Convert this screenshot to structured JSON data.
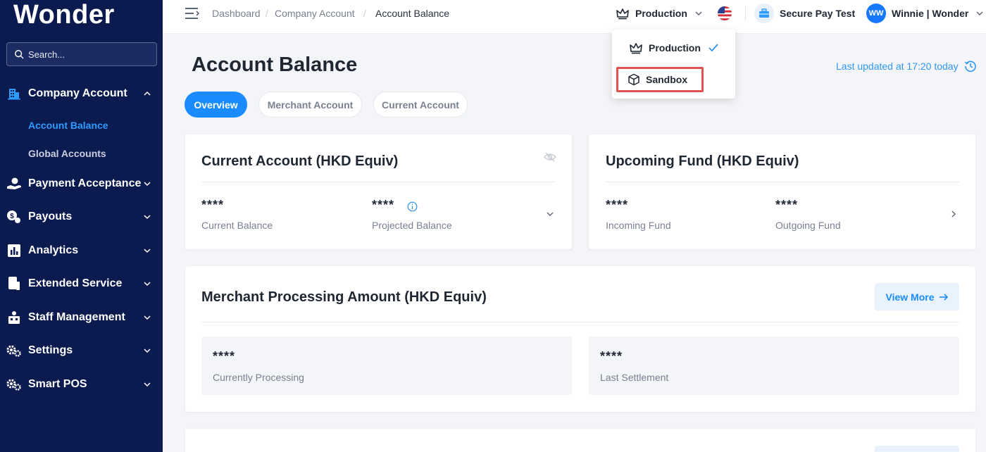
{
  "sidebar": {
    "logo": "Wonder",
    "search_placeholder": "Search...",
    "items": [
      {
        "label": "Company Account",
        "icon": "building-icon",
        "expanded": true
      },
      {
        "label": "Payment Acceptance",
        "icon": "hand-coin-icon"
      },
      {
        "label": "Payouts",
        "icon": "payout-icon"
      },
      {
        "label": "Analytics",
        "icon": "bar-chart-icon"
      },
      {
        "label": "Extended Service",
        "icon": "device-icon"
      },
      {
        "label": "Staff Management",
        "icon": "staff-icon"
      },
      {
        "label": "Settings",
        "icon": "gears-icon"
      },
      {
        "label": "Smart POS",
        "icon": "gears-icon"
      }
    ],
    "sub_items": [
      {
        "label": "Account Balance",
        "active": true
      },
      {
        "label": "Global Accounts",
        "active": false
      }
    ]
  },
  "topbar": {
    "breadcrumb": [
      "Dashboard",
      "Company Account",
      "Account Balance"
    ],
    "breadcrumb_separator": "/",
    "environment": "Production",
    "merchant": "Secure Pay Test",
    "user_initials": "WW",
    "user_name": "Winnie | Wonder"
  },
  "env_dropdown": {
    "options": [
      {
        "label": "Production",
        "selected": true
      },
      {
        "label": "Sandbox",
        "selected": false
      }
    ]
  },
  "main": {
    "title": "Account Balance",
    "last_updated": "Last updated at 17:20 today",
    "tabs": [
      {
        "label": "Overview",
        "active": true
      },
      {
        "label": "Merchant Account",
        "active": false
      },
      {
        "label": "Current Account",
        "active": false
      }
    ],
    "current_account": {
      "title": "Current Account (HKD Equiv)",
      "metrics": [
        {
          "value": "****",
          "label": "Current Balance"
        },
        {
          "value": "****",
          "label": "Projected Balance"
        }
      ]
    },
    "upcoming_fund": {
      "title": "Upcoming Fund (HKD Equiv)",
      "metrics": [
        {
          "value": "****",
          "label": "Incoming Fund"
        },
        {
          "value": "****",
          "label": "Outgoing Fund"
        }
      ]
    },
    "merchant_processing": {
      "title": "Merchant Processing Amount (HKD Equiv)",
      "view_more": "View More",
      "metrics": [
        {
          "value": "****",
          "label": "Currently Processing"
        },
        {
          "value": "****",
          "label": "Last Settlement"
        }
      ]
    }
  },
  "colors": {
    "sidebar_bg": "#0b1a4f",
    "accent": "#1a8cff",
    "highlight_border": "#e05252"
  }
}
